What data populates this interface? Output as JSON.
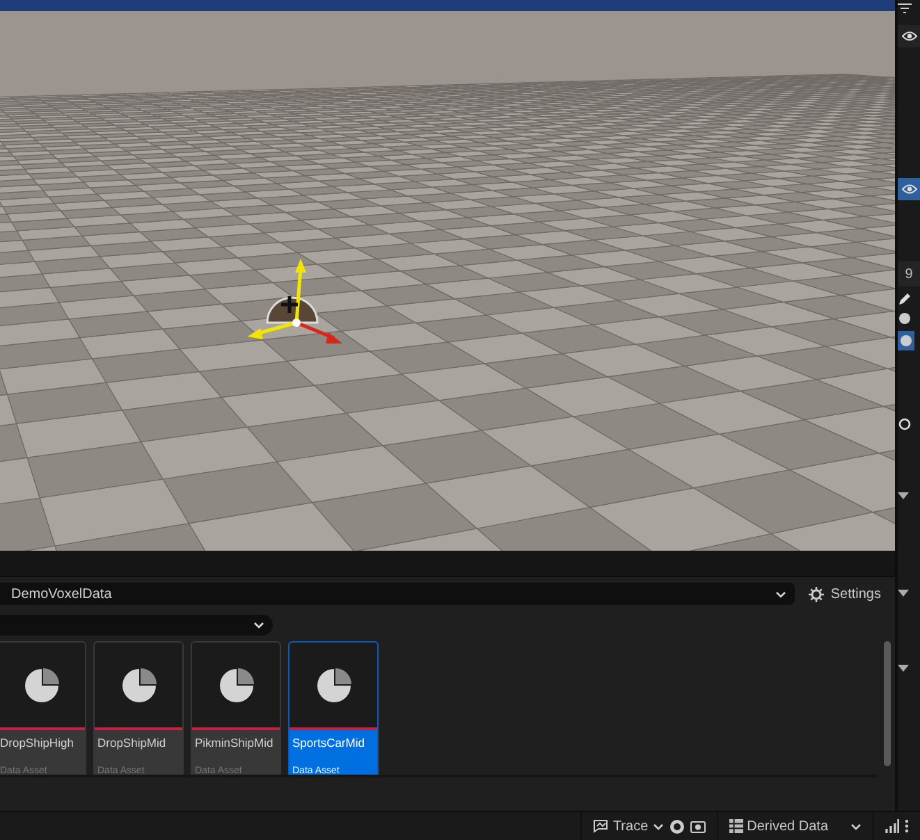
{
  "outliner": {
    "rows": [
      {
        "selected": false
      },
      {
        "selected": true
      }
    ],
    "count_label": "9"
  },
  "content_browser": {
    "path": "DemoVoxelData",
    "settings_label": "Settings",
    "assets": [
      {
        "name": "DropShipHigh",
        "type": "Data Asset",
        "selected": false
      },
      {
        "name": "DropShipMid",
        "type": "Data Asset",
        "selected": false
      },
      {
        "name": "PikminShipMid",
        "type": "Data Asset",
        "selected": false
      },
      {
        "name": "SportsCarMid",
        "type": "Data Asset",
        "selected": true
      }
    ]
  },
  "status_bar": {
    "trace_label": "Trace",
    "derived_data_label": "Derived Data"
  }
}
